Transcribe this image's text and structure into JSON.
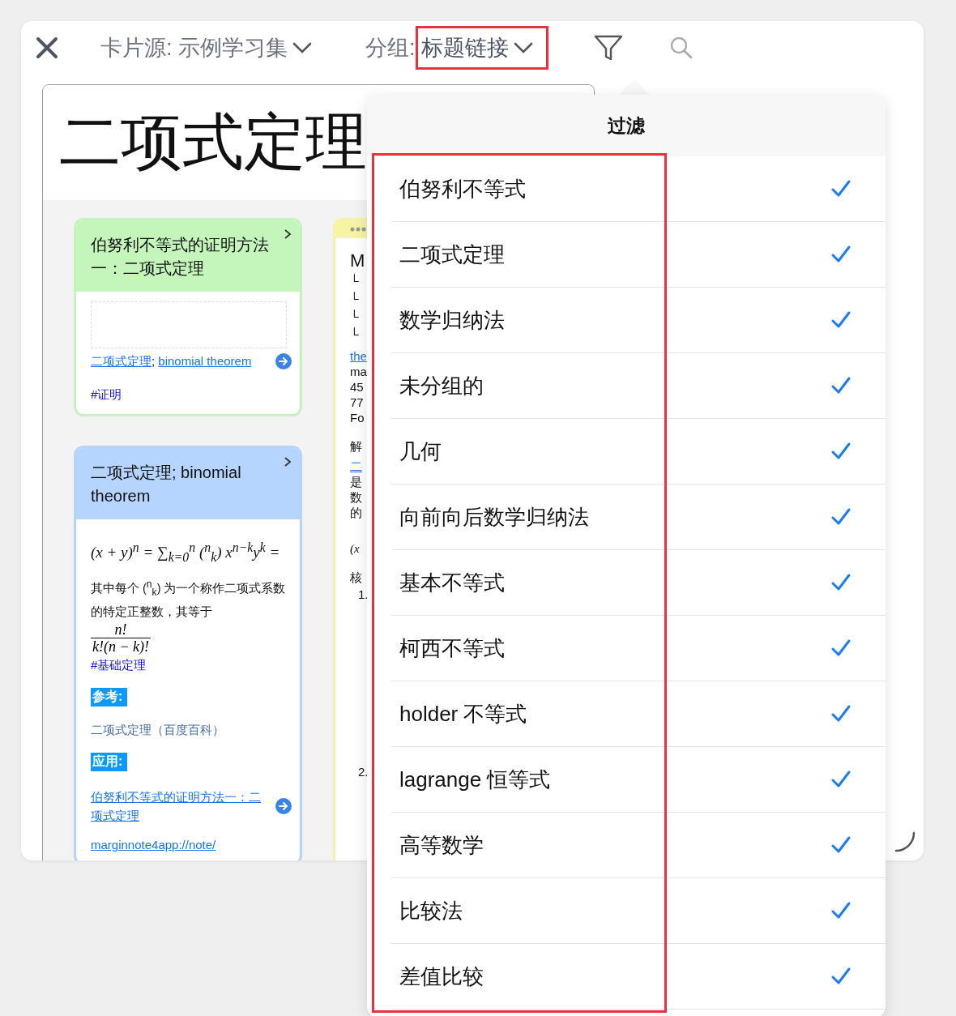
{
  "toolbar": {
    "source": {
      "label": "卡片源: 示例学习集"
    },
    "group": {
      "label": "分组:",
      "value": "标题链接"
    }
  },
  "document": {
    "title": "二项式定理"
  },
  "cards": [
    {
      "kind": "green",
      "title": "伯努利不等式的证明方法一：二项式定理",
      "links": [
        {
          "text": "二项式定理"
        },
        {
          "text": "binomial theorem"
        }
      ],
      "link_separator": "; ",
      "tag": "#证明"
    },
    {
      "kind": "blue",
      "title": "二项式定理; binomial theorem",
      "formula": "(x + y)$^{n}$ = ∑$_{k=0}$$^{n}$ ($^{n}$$_{k}$) x$^{n−k}$y$^{k}$ =",
      "sentence": "其中每个 ($^{n}$$_{k}$) 为一个称作二项式系数的特定正整数，其等于",
      "fraction_top": "n!",
      "fraction_bottom": "k!(n − k)!",
      "tag": "#基础定理",
      "sections": [
        {
          "label": "参考:",
          "items": [
            {
              "text": "二项式定理（百度百科）",
              "kind": "reference"
            }
          ]
        },
        {
          "label": "应用:",
          "items": [
            {
              "text": "伯努利不等式的证明方法一：二项式定理",
              "kind": "link"
            },
            {
              "text": "marginnote4app://note/",
              "kind": "url"
            }
          ]
        }
      ]
    }
  ],
  "side_card": {
    "lines": [
      {
        "kind": "heading",
        "text": "M"
      },
      {
        "kind": "tree",
        "text": "└"
      },
      {
        "kind": "tree",
        "text": "└"
      },
      {
        "kind": "tree",
        "text": "└"
      },
      {
        "kind": "tree",
        "text": "└"
      },
      {
        "kind": "link",
        "text": "the"
      },
      {
        "kind": "text",
        "text": "ma"
      },
      {
        "kind": "text",
        "text": "45"
      },
      {
        "kind": "text",
        "text": "77"
      },
      {
        "kind": "text",
        "text": "Fo"
      },
      {
        "kind": "para",
        "text": "解"
      },
      {
        "kind": "link",
        "text": "二"
      },
      {
        "kind": "text",
        "text": "是"
      },
      {
        "kind": "text",
        "text": "数"
      },
      {
        "kind": "text",
        "text": "的"
      },
      {
        "kind": "math",
        "text": "(x"
      },
      {
        "kind": "para",
        "text": "核"
      },
      {
        "kind": "item",
        "text": "1."
      },
      {
        "kind": "far",
        "text": "2."
      }
    ]
  },
  "filter_popover": {
    "title": "过滤",
    "items": [
      {
        "label": "伯努利不等式",
        "checked": true
      },
      {
        "label": "二项式定理",
        "checked": true
      },
      {
        "label": "数学归纳法",
        "checked": true
      },
      {
        "label": "未分组的",
        "checked": true
      },
      {
        "label": "几何",
        "checked": true
      },
      {
        "label": "向前向后数学归纳法",
        "checked": true
      },
      {
        "label": "基本不等式",
        "checked": true
      },
      {
        "label": "柯西不等式",
        "checked": true
      },
      {
        "label": "holder 不等式",
        "checked": true
      },
      {
        "label": "lagrange 恒等式",
        "checked": true
      },
      {
        "label": "高等数学",
        "checked": true
      },
      {
        "label": "比较法",
        "checked": true
      },
      {
        "label": "差值比较",
        "checked": true
      }
    ]
  }
}
